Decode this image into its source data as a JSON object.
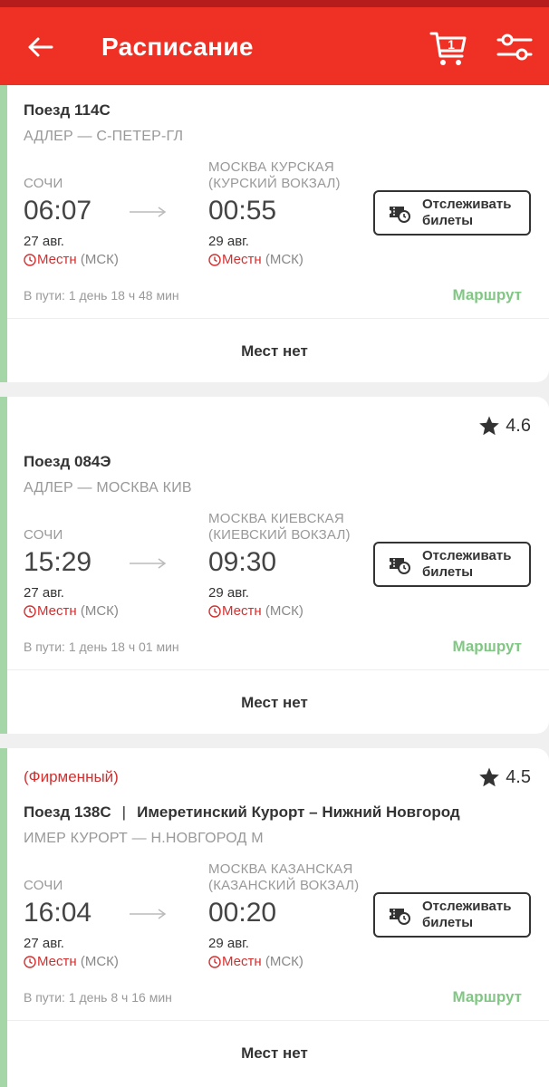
{
  "header": {
    "title": "Расписание",
    "cart_count": "1"
  },
  "trains": [
    {
      "branded": "",
      "rating": "",
      "train_number": "Поезд 114С",
      "train_name": "",
      "route_code": "АДЛЕР — С-ПЕТЕР-ГЛ",
      "departure": {
        "station_line1": "СОЧИ",
        "station_line2": "",
        "time": "06:07",
        "date": "27 авг.",
        "tz_local": "Местн",
        "tz_msk": "(МСК)"
      },
      "arrival": {
        "station_line1": "МОСКВА КУРСКАЯ",
        "station_line2": "(КУРСКИЙ ВОКЗАЛ)",
        "time": "00:55",
        "date": "29 авг.",
        "tz_local": "Местн",
        "tz_msk": "(МСК)"
      },
      "track_label_1": "Отслеживать",
      "track_label_2": "билеты",
      "duration": "В пути: 1 день 18 ч 48 мин",
      "route_link": "Маршрут",
      "availability": "Мест нет"
    },
    {
      "branded": "",
      "rating": "4.6",
      "train_number": "Поезд 084Э",
      "train_name": "",
      "route_code": "АДЛЕР — МОСКВА КИВ",
      "departure": {
        "station_line1": "СОЧИ",
        "station_line2": "",
        "time": "15:29",
        "date": "27 авг.",
        "tz_local": "Местн",
        "tz_msk": "(МСК)"
      },
      "arrival": {
        "station_line1": "МОСКВА КИЕВСКАЯ",
        "station_line2": "(КИЕВСКИЙ ВОКЗАЛ)",
        "time": "09:30",
        "date": "29 авг.",
        "tz_local": "Местн",
        "tz_msk": "(МСК)"
      },
      "track_label_1": "Отслеживать",
      "track_label_2": "билеты",
      "duration": "В пути: 1 день 18 ч 01 мин",
      "route_link": "Маршрут",
      "availability": "Мест нет"
    },
    {
      "branded": "(Фирменный)",
      "rating": "4.5",
      "train_number": "Поезд 138С",
      "train_name": "Имеретинский Курорт – Нижний Новгород",
      "route_code": "ИМЕР КУРОРТ — Н.НОВГОРОД М",
      "departure": {
        "station_line1": "СОЧИ",
        "station_line2": "",
        "time": "16:04",
        "date": "27 авг.",
        "tz_local": "Местн",
        "tz_msk": "(МСК)"
      },
      "arrival": {
        "station_line1": "МОСКВА КАЗАНСКАЯ",
        "station_line2": "(КАЗАНСКИЙ ВОКЗАЛ)",
        "time": "00:20",
        "date": "29 авг.",
        "tz_local": "Местн",
        "tz_msk": "(МСК)"
      },
      "track_label_1": "Отслеживать",
      "track_label_2": "билеты",
      "duration": "В пути: 1 день 8 ч 16 мин",
      "route_link": "Маршрут",
      "availability": "Мест нет"
    }
  ],
  "colors": {
    "header": "#ee3124",
    "accent_green": "#81c784",
    "local_time_red": "#d32f2f"
  },
  "icons": {
    "back": "arrow-left-icon",
    "cart": "cart-icon",
    "filter": "sliders-icon",
    "rating": "star-icon",
    "arrow": "arrow-right-icon",
    "clock": "clock-icon",
    "track": "ticket-clock-icon"
  }
}
